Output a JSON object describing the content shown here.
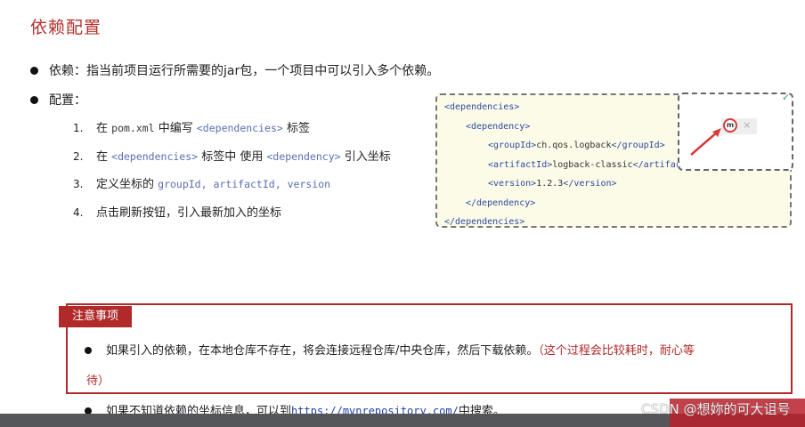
{
  "page": {
    "title": "依赖配置",
    "bullets": [
      {
        "text": "依赖：指当前项目运行所需要的jar包，一个项目中可以引入多个依赖。"
      },
      {
        "text": "配置："
      }
    ],
    "steps": [
      {
        "num": "1.",
        "pre": "在 ",
        "code_black": "pom.xml",
        "mid": " 中编写 ",
        "code": "<dependencies>",
        "post": " 标签"
      },
      {
        "num": "2.",
        "pre": "在 ",
        "code": "<dependencies>",
        "mid": " 标签中 使用 ",
        "code2": "<dependency>",
        "post": " 引入坐标"
      },
      {
        "num": "3.",
        "pre": "定义坐标的 ",
        "code": "groupId",
        "sep1": ", ",
        "code2": "artifactId",
        "sep2": ", ",
        "code3": "version"
      },
      {
        "num": "4.",
        "text": "点击刷新按钮，引入最新加入的坐标"
      }
    ]
  },
  "code_snippet": {
    "lines": [
      {
        "text": "<dependencies>"
      },
      {
        "text": "<dependency>"
      },
      {
        "open": "<groupId>",
        "value": "ch.qos.logback",
        "close": "</groupId>"
      },
      {
        "open": "<artifactId>",
        "value": "logback-classic",
        "close": "</artifac"
      },
      {
        "open": "<version>",
        "value": "1.2.3",
        "close": "</version>"
      },
      {
        "text": "</dependency>"
      },
      {
        "text": "</dependencies>"
      }
    ]
  },
  "maven_popup": {
    "icon_label": "m",
    "close_glyph": "×",
    "check_glyph": "✓"
  },
  "notice": {
    "tag": "注意事项",
    "item1_main": "如果引入的依赖，在本地仓库不存在，将会连接远程仓库/中央仓库，然后下载依赖。",
    "item1_red": "（这个过程会比较耗时，耐心等",
    "item1_red_cont": "待）",
    "item2_pre": "如果不知道依赖的坐标信息，可以到",
    "item2_link": "https://mvnrepository.com/",
    "item2_post": "中搜索。"
  },
  "watermark": {
    "text": "CSDN @想妳的可大诅号"
  },
  "colors": {
    "accent_red": "#b02a2a",
    "title_red": "#b5312d",
    "code_blue": "#2f4aa0",
    "code_bg": "#fbfbe8"
  }
}
